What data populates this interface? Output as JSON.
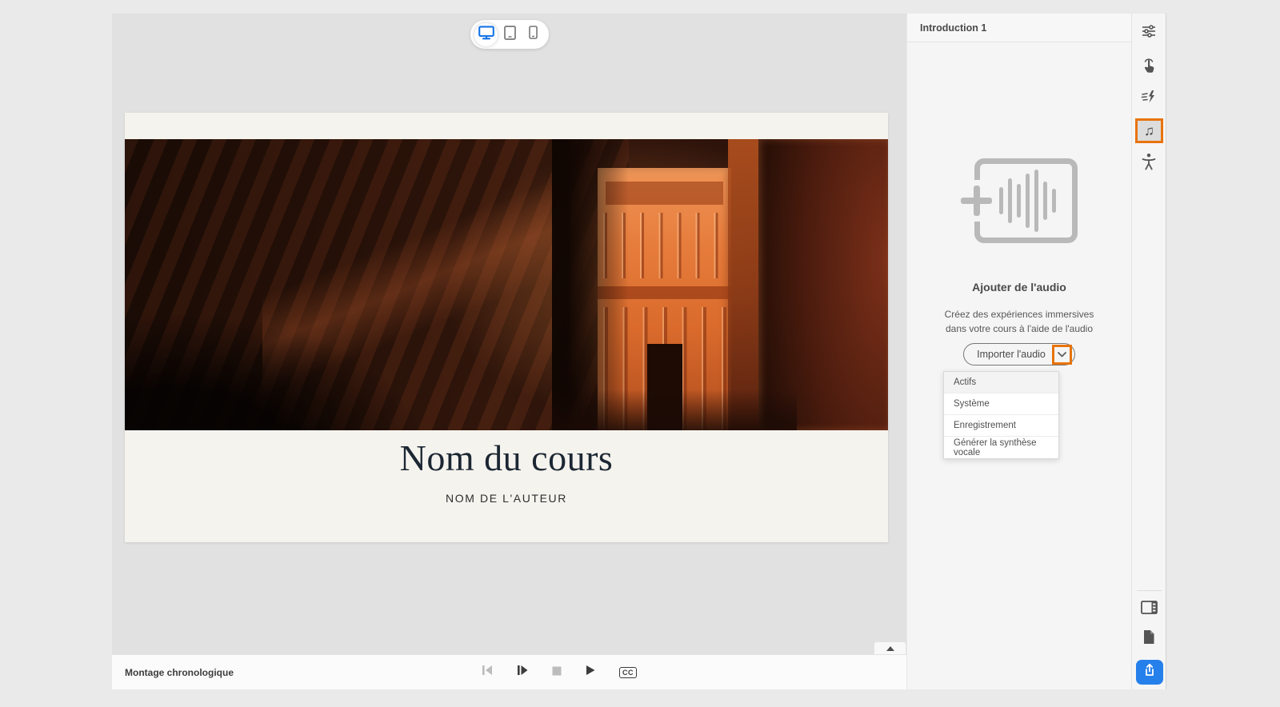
{
  "canvas": {
    "device_switcher": {
      "options": [
        {
          "id": "desktop",
          "icon": "desktop-icon",
          "selected": true
        },
        {
          "id": "tablet",
          "icon": "tablet-icon",
          "selected": false
        },
        {
          "id": "mobile",
          "icon": "mobile-icon",
          "selected": false
        }
      ]
    },
    "slide": {
      "title": "Nom du cours",
      "author": "NOM DE L'AUTEUR",
      "image": "petra-canyon-photo"
    },
    "collapse_tab_icon": "chevron-up-icon"
  },
  "timeline": {
    "label": "Montage chronologique",
    "controls": [
      {
        "icon": "skip-back-icon",
        "disabled": true
      },
      {
        "icon": "step-forward-icon",
        "disabled": false
      },
      {
        "icon": "stop-icon",
        "disabled": true
      },
      {
        "icon": "play-icon",
        "disabled": false
      },
      {
        "icon": "closed-captions-icon",
        "disabled": false
      }
    ],
    "cc_label": "CC"
  },
  "panel": {
    "header": "Introduction 1",
    "audio": {
      "placeholder_icon": "add-audio-waveform-icon",
      "title": "Ajouter de l'audio",
      "description_line1": "Créez des expériences immersives",
      "description_line2": "dans votre cours à l'aide de l'audio",
      "import_button_label": "Importer l'audio",
      "dropdown_icon": "chevron-down-icon",
      "menu_items": [
        "Actifs",
        "Système",
        "Enregistrement",
        "Générer la synthèse vocale"
      ]
    }
  },
  "toolbar": {
    "top_icons": [
      "sliders-icon",
      "interaction-hand-icon",
      "animation-lightning-icon",
      "music-note-icon",
      "accessibility-icon"
    ],
    "active_tool": "audio",
    "music_note_glyph": "♫",
    "bottom_icons": [
      "preview-panel-icon",
      "notes-page-icon",
      "share-icon"
    ]
  },
  "colors": {
    "accent_orange": "#E8740C",
    "accent_blue": "#1473E6",
    "share_blue": "#2680EB"
  }
}
